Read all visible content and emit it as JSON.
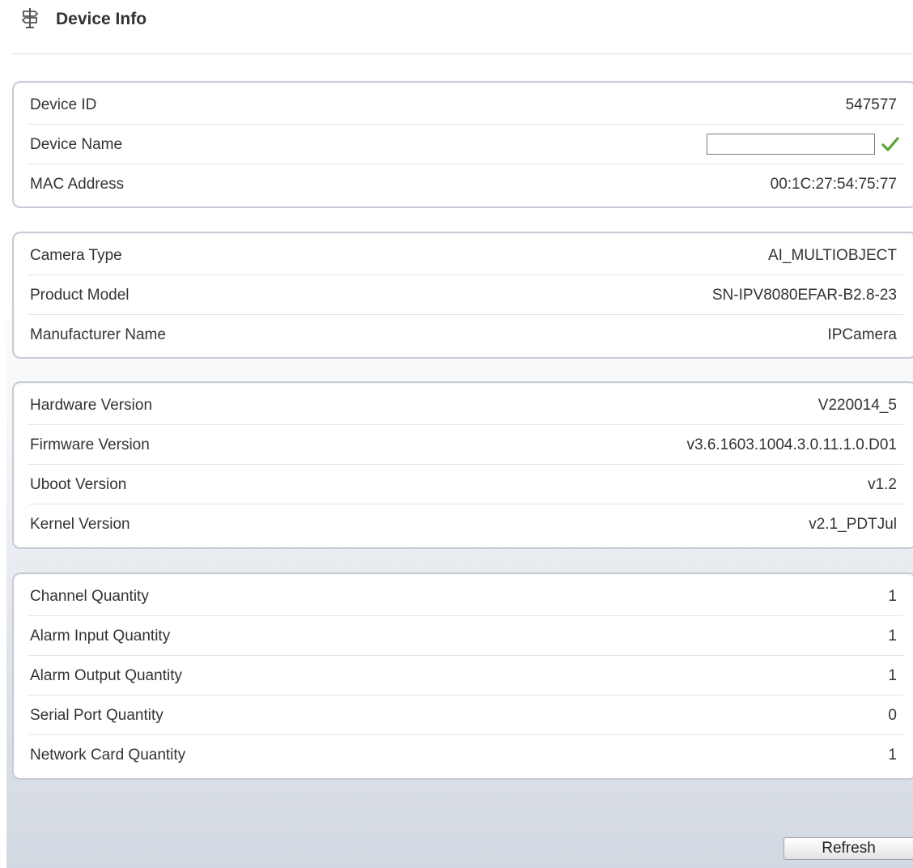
{
  "header": {
    "title": "Device Info",
    "icon": "signpost-icon"
  },
  "groups": [
    {
      "rows": [
        {
          "label": "Device ID",
          "value": "547577"
        },
        {
          "label": "Device Name",
          "value": ""
        },
        {
          "label": "MAC Address",
          "value": "00:1C:27:54:75:77"
        }
      ]
    },
    {
      "rows": [
        {
          "label": "Camera Type",
          "value": "AI_MULTIOBJECT"
        },
        {
          "label": "Product Model",
          "value": "SN-IPV8080EFAR-B2.8-23"
        },
        {
          "label": "Manufacturer Name",
          "value": "IPCamera"
        }
      ]
    },
    {
      "rows": [
        {
          "label": "Hardware Version",
          "value": "V220014_5"
        },
        {
          "label": "Firmware Version",
          "value": "v3.6.1603.1004.3.0.11.1.0.D01"
        },
        {
          "label": "Uboot Version",
          "value": "v1.2"
        },
        {
          "label": "Kernel Version",
          "value": "v2.1_PDTJul"
        }
      ]
    },
    {
      "rows": [
        {
          "label": "Channel Quantity",
          "value": "1"
        },
        {
          "label": "Alarm Input Quantity",
          "value": "1"
        },
        {
          "label": "Alarm Output Quantity",
          "value": "1"
        },
        {
          "label": "Serial Port Quantity",
          "value": "0"
        },
        {
          "label": "Network Card Quantity",
          "value": "1"
        }
      ]
    }
  ],
  "device_name_confirm_icon": "checkmark-icon",
  "refresh_label": "Refresh",
  "colors": {
    "checkmark": "#5aa532",
    "group_border": "#c6cbd5"
  }
}
